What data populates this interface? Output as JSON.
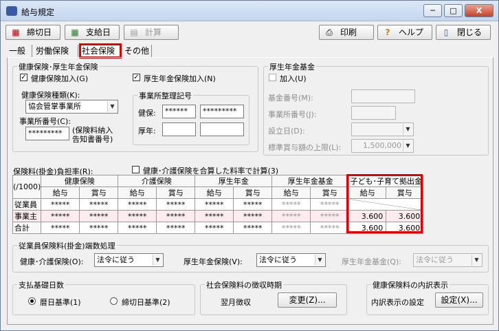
{
  "window": {
    "title": "給与規定",
    "min": "─",
    "max": "□",
    "close": "X"
  },
  "toolbar": {
    "shimekiri": "締切日",
    "shikyu": "支給日",
    "keisan": "計算",
    "insatsu": "印刷",
    "help": "ヘルプ",
    "close": "閉じる"
  },
  "tabs": [
    "一般",
    "労働保険",
    "社会保険",
    "その他"
  ],
  "kenko": {
    "group": "健康保険･厚生年金保険",
    "kenko_kanyu": "健康保険加入(G)",
    "kosei_kanyu": "厚生年金保険加入(N)",
    "type_label": "健康保険種類(K):",
    "type_value": "協会管掌事業所",
    "office_label": "事業所番号(C):",
    "office_value": "*********",
    "office_note1": "(保険料納入",
    "office_note2": "告知書番号)",
    "seiri_group": "事業所整理記号",
    "kenpo_label": "健保:",
    "kenpo_a": "******",
    "kenpo_b": "*********",
    "konen_label": "厚年:"
  },
  "nenkin": {
    "group": "厚生年金基金",
    "kanyu": "加入(U)",
    "kikin_label": "基金番号(M):",
    "office_label": "事業所番号(J):",
    "setsuritsu_label": "設立日(D):",
    "jogen_label": "標準賞与額の上限(L):",
    "jogen_value": "1,500,000"
  },
  "rate": {
    "label": "保険料(掛金)負担率(R):",
    "merge": "健康･介護保険を合算した料率で計算(3)",
    "unit": "(/1000)",
    "groups": [
      "健康保険",
      "介護保険",
      "厚生年金",
      "厚生年金基金",
      "子ども･子育て拠出金"
    ],
    "sub": [
      "給与",
      "賞与"
    ],
    "rows": [
      {
        "label": "従業員",
        "values": [
          "*****",
          "*****",
          "*****",
          "*****",
          "*****",
          "*****",
          "*****",
          "*****",
          "",
          ""
        ]
      },
      {
        "label": "事業主",
        "values": [
          "*****",
          "*****",
          "*****",
          "*****",
          "*****",
          "*****",
          "*****",
          "*****",
          "3.600",
          "3.600"
        ]
      },
      {
        "label": "合計",
        "values": [
          "*****",
          "*****",
          "*****",
          "*****",
          "*****",
          "*****",
          "*****",
          "*****",
          "3.600",
          "3.600"
        ]
      }
    ]
  },
  "rounding": {
    "group": "従業員保険料(掛金)端数処理",
    "kaigo_label": "健康･介護保険(O):",
    "kaigo_value": "法令に従う",
    "kosei_label": "厚生年金保険(V):",
    "kosei_value": "法令に従う",
    "kikin_label": "厚生年金基金(Q):",
    "kikin_value": "法令に従う"
  },
  "kijun": {
    "group": "支払基礎日数",
    "opt1": "暦日基準(1)",
    "opt2": "締切日基準(2)"
  },
  "choshu": {
    "group": "社会保険料の徴収時期",
    "value": "翌月徴収",
    "btn": "変更(Z)..."
  },
  "uchiwake": {
    "group": "健康保険料の内訳表示",
    "label": "内訳表示の設定",
    "btn": "設定(X)..."
  }
}
